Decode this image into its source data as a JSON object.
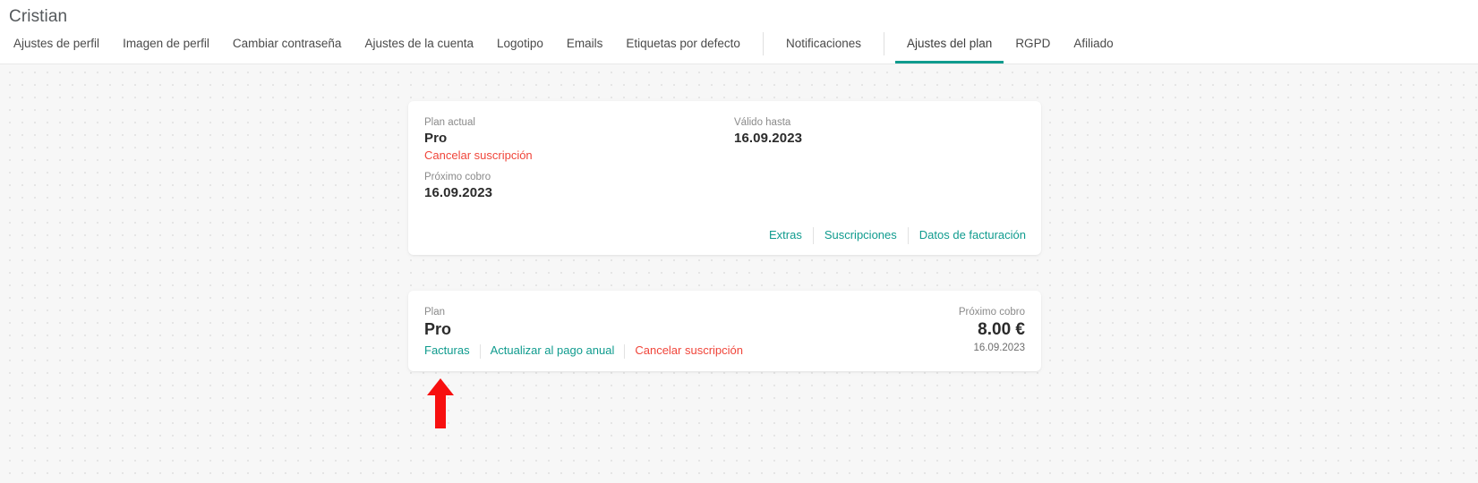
{
  "header": {
    "title": "Cristian",
    "tabs": [
      {
        "label": "Ajustes de perfil",
        "active": false,
        "sep_after": false
      },
      {
        "label": "Imagen de perfil",
        "active": false,
        "sep_after": false
      },
      {
        "label": "Cambiar contraseña",
        "active": false,
        "sep_after": false
      },
      {
        "label": "Ajustes de la cuenta",
        "active": false,
        "sep_after": false
      },
      {
        "label": "Logotipo",
        "active": false,
        "sep_after": false
      },
      {
        "label": "Emails",
        "active": false,
        "sep_after": false
      },
      {
        "label": "Etiquetas por defecto",
        "active": false,
        "sep_after": true
      },
      {
        "label": "Notificaciones",
        "active": false,
        "sep_after": true
      },
      {
        "label": "Ajustes del plan",
        "active": true,
        "sep_after": false
      },
      {
        "label": "RGPD",
        "active": false,
        "sep_after": false
      },
      {
        "label": "Afiliado",
        "active": false,
        "sep_after": false
      }
    ]
  },
  "plan_summary_card": {
    "current_plan_label": "Plan actual",
    "current_plan_value": "Pro",
    "cancel_link": "Cancelar suscripción",
    "next_charge_label": "Próximo cobro",
    "next_charge_value": "16.09.2023",
    "valid_until_label": "Válido hasta",
    "valid_until_value": "16.09.2023",
    "actions": [
      {
        "label": "Extras"
      },
      {
        "label": "Suscripciones"
      },
      {
        "label": "Datos de facturación"
      }
    ]
  },
  "plan_item_card": {
    "plan_label": "Plan",
    "plan_value": "Pro",
    "links": [
      {
        "label": "Facturas",
        "kind": "teal"
      },
      {
        "label": "Actualizar al pago anual",
        "kind": "teal"
      },
      {
        "label": "Cancelar suscripción",
        "kind": "danger"
      }
    ],
    "next_charge_label": "Próximo cobro",
    "price": "8.00 €",
    "price_date": "16.09.2023"
  },
  "annotation": {
    "arrow_icon": "up-arrow-icon",
    "color": "#f70f0f",
    "points_at": "Facturas"
  },
  "colors": {
    "accent_teal": "#0f9b8e",
    "danger_red": "#f0453a",
    "annotation_red": "#f70f0f",
    "page_bg": "#f7f7f7",
    "card_bg": "#ffffff",
    "title_gray": "#55595c"
  }
}
